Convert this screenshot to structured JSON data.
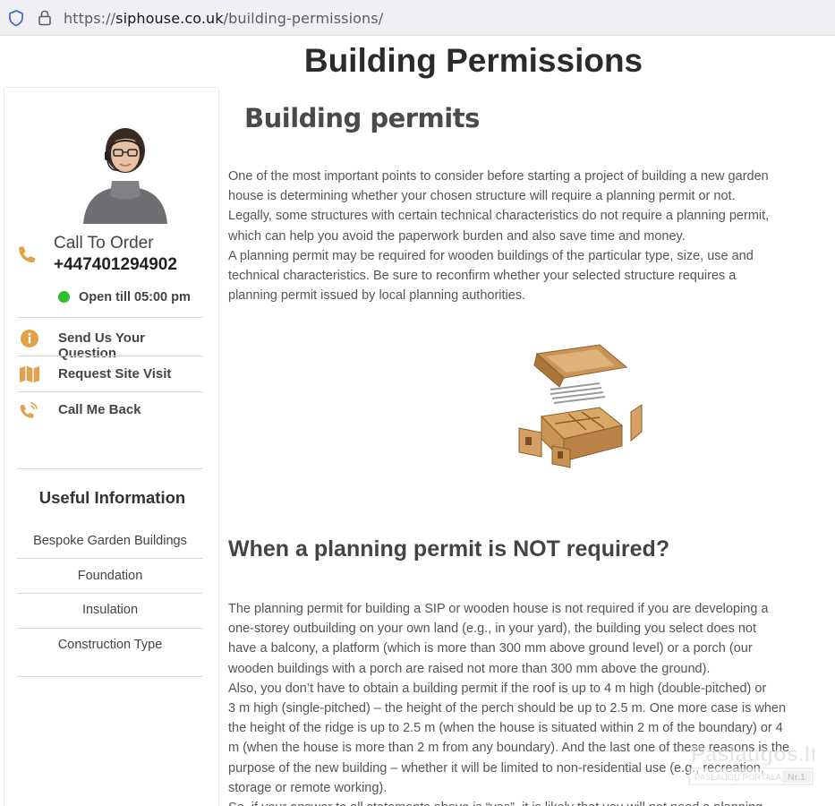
{
  "browser": {
    "url_prefix": "https://",
    "url_domain": "siphouse.co.uk",
    "url_path": "/building-permissions/"
  },
  "page": {
    "title": "Building Permissions"
  },
  "sidebar": {
    "call_label": "Call To Order",
    "phone": "+447401294902",
    "open_status": "Open till 05:00 pm",
    "status_color": "#2ec02e",
    "accent_color": "#e0a24a",
    "menu": [
      {
        "label": "Send Us Your Question",
        "icon": "info-icon"
      },
      {
        "label": "Request Site Visit",
        "icon": "map-icon"
      },
      {
        "label": "Call Me Back",
        "icon": "phone-ringing-icon"
      }
    ],
    "useful_title": "Useful Information",
    "links": [
      "Bespoke Garden Buildings",
      "Foundation",
      "Insulation",
      "Construction Type"
    ]
  },
  "main": {
    "heading": "Building permits",
    "paragraph1_lines": [
      "One of the most important points to consider before starting a project of building a new garden",
      "house is determining whether your chosen structure will require a planning permit or not.",
      "Legally, some structures with certain technical characteristics do not require a planning permit,",
      "which can help you avoid the paperwork burden and also save time and money.",
      "A planning permit may be required for wooden buildings of the particular type, size, use and",
      "technical characteristics. Be sure to reconfirm whether your selected structure requires a",
      "planning permit issued by local planning authorities."
    ],
    "subheading": "When a planning permit is NOT required?",
    "paragraph2_lines": [
      "The planning permit for building a SIP or wooden house is not required if you are developing a",
      "one-storey outbuilding on your own land (e.g., in your yard), the building you select does not",
      "have a balcony, a platform (which is more than 300 mm above ground level) or a porch (our",
      "wooden buildings with a porch are raised not more than 300 mm above the ground).",
      "Also, you don’t have to obtain a building permit if the roof is up to 4 m high (double-pitched) or",
      "3 m high (single-pitched) – the height of the perch should be up to 2.5 m. One more case is when",
      "the height of the ridge is up to 2.5 m (when the house is situated within 2 m of the boundary) or 4",
      "m (when the house is more than 2 m from any boundary). And the last one of these reasons is the",
      "purpose of the new building – whether it will be limited to non-residential use (e.g., recreation,",
      "storage or remote working).",
      "So, if your answer to all statements above is “yes”, it is likely that you will not need a planning"
    ]
  },
  "watermark": {
    "brand": "Paslaugos.lt",
    "tagline": "PASLAUGŲ PORTALAS",
    "badge": "Nr.1"
  }
}
